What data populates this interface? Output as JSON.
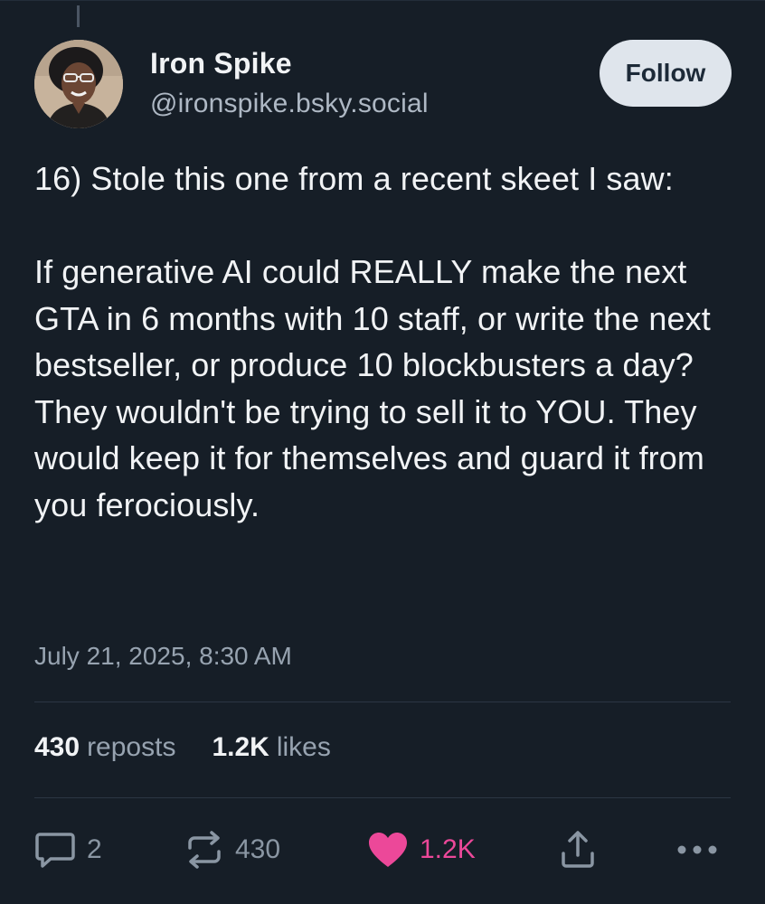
{
  "author": {
    "display_name": "Iron Spike",
    "handle": "@ironspike.bsky.social",
    "avatar_icon": "avatar-photo"
  },
  "follow_button": {
    "label": "Follow"
  },
  "post": {
    "text": "16) Stole this one from a recent skeet I saw:\n\nIf generative AI could REALLY make the next GTA in 6 months with 10 staff, or write the next bestseller, or produce 10 blockbusters a day? They wouldn't be trying to sell it to YOU. They would keep it for themselves and guard it from you ferociously.",
    "timestamp": "July 21, 2025, 8:30 AM"
  },
  "stats": {
    "reposts_count": "430",
    "reposts_label": "reposts",
    "likes_count": "1.2K",
    "likes_label": "likes"
  },
  "actions": {
    "reply_count": "2",
    "repost_count": "430",
    "like_count": "1.2K"
  },
  "colors": {
    "background": "#161e27",
    "like_accent": "#ec4899",
    "follow_bg": "#dfe5ec"
  }
}
